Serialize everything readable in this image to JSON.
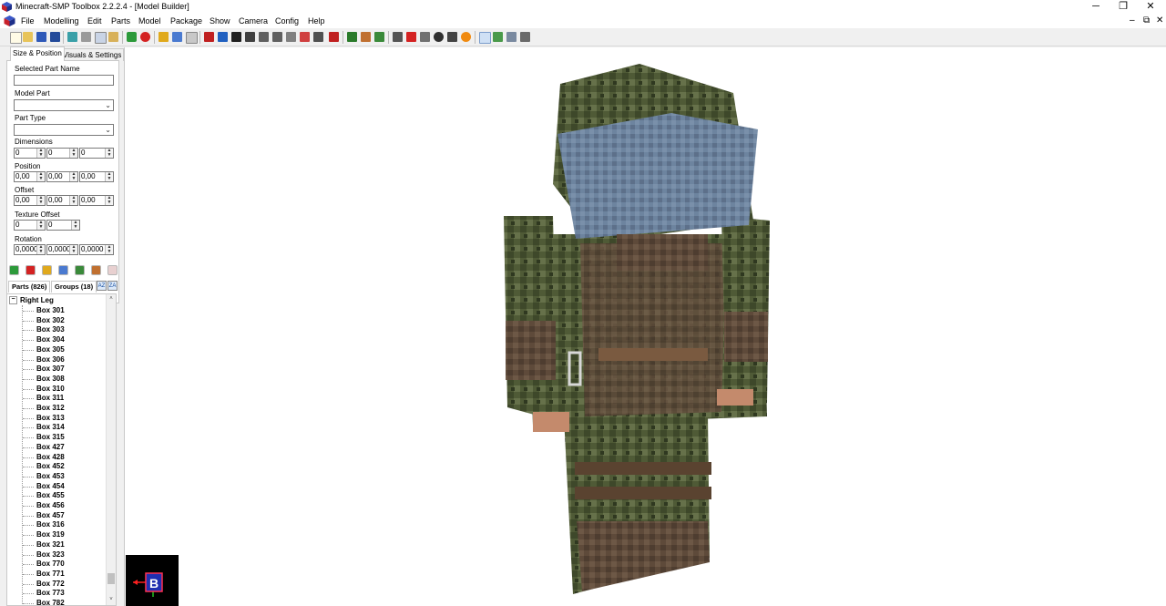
{
  "window": {
    "title": "Minecraft-SMP Toolbox 2.2.2.4 - [Model Builder]",
    "controls": [
      "─",
      "❐",
      "✕"
    ]
  },
  "menu": {
    "items": [
      "File",
      "Modelling",
      "Edit",
      "Parts",
      "Model",
      "Package",
      "Show",
      "Camera",
      "Config",
      "Help"
    ],
    "mdi_controls": [
      "–",
      "⧉",
      "✕"
    ]
  },
  "toolbar": {
    "icons": [
      "new-file-icon",
      "open-folder-icon",
      "save-icon",
      "save-as-icon",
      "copy-texture-icon",
      "cut-icon",
      "copy-icon",
      "paste-icon",
      "add-box-icon",
      "add-sphere-icon",
      "pencil-icon",
      "group-icon",
      "delete-part-icon",
      "mirror-x-icon",
      "mirror-y-icon",
      "mirror-z-icon",
      "flip-icon",
      "rotate-left-icon",
      "rotate-right-icon",
      "eraser-icon",
      "wireframe-icon",
      "move-icon",
      "texture-map-icon",
      "paint-brush-icon",
      "uv-icon",
      "close-x-icon",
      "red-square-icon",
      "shape-icon",
      "ball-icon",
      "lamp-icon",
      "sun-icon",
      "grid-icon",
      "checklist-icon",
      "settings-icon",
      "camera-tools-icon"
    ]
  },
  "panel": {
    "tabs": [
      "Size & Position",
      "Visuals & Settings"
    ],
    "selected_part_name_label": "Selected Part Name",
    "selected_part_name_value": "",
    "model_part_label": "Model Part",
    "model_part_value": "",
    "part_type_label": "Part Type",
    "part_type_value": "",
    "dimensions_label": "Dimensions",
    "dimensions": [
      "0",
      "0",
      "0"
    ],
    "position_label": "Position",
    "position": [
      "0,00",
      "0,00",
      "0,00"
    ],
    "offset_label": "Offset",
    "offset": [
      "0,00",
      "0,00",
      "0,00"
    ],
    "texture_offset_label": "Texture Offset",
    "texture_offset": [
      "0",
      "0"
    ],
    "rotation_label": "Rotation",
    "rotation": [
      "0,0000",
      "0,0000",
      "0,0000"
    ],
    "spin_up": "▲",
    "spin_down": "▼",
    "combo_arrow": "⌄"
  },
  "parts": {
    "tabs": [
      "Parts (826)",
      "Groups (18)"
    ],
    "sort_labels": [
      "AZ",
      "ZA"
    ],
    "tree_root": "Right Leg",
    "collapse_symbol": "−",
    "items": [
      "Box 301",
      "Box 302",
      "Box 303",
      "Box 304",
      "Box 305",
      "Box 306",
      "Box 307",
      "Box 308",
      "Box 310",
      "Box 311",
      "Box 312",
      "Box 313",
      "Box 314",
      "Box 315",
      "Box 427",
      "Box 428",
      "Box 452",
      "Box 453",
      "Box 454",
      "Box 455",
      "Box 456",
      "Box 457",
      "Box 316",
      "Box 319",
      "Box 321",
      "Box 323",
      "Box 770",
      "Box 771",
      "Box 772",
      "Box 773",
      "Box 782"
    ],
    "scroll_up": "˄",
    "scroll_down": "˅"
  },
  "gizmo": {
    "label": "B"
  },
  "colors": {
    "camo_dark": "#3f4a2c",
    "camo_mid": "#55613b",
    "camo_light": "#6e7a50",
    "visor_blue": "#6f86a2",
    "leather_brown": "#5f4a38",
    "skin": "#c48a6c",
    "strap": "#7a5a40"
  }
}
